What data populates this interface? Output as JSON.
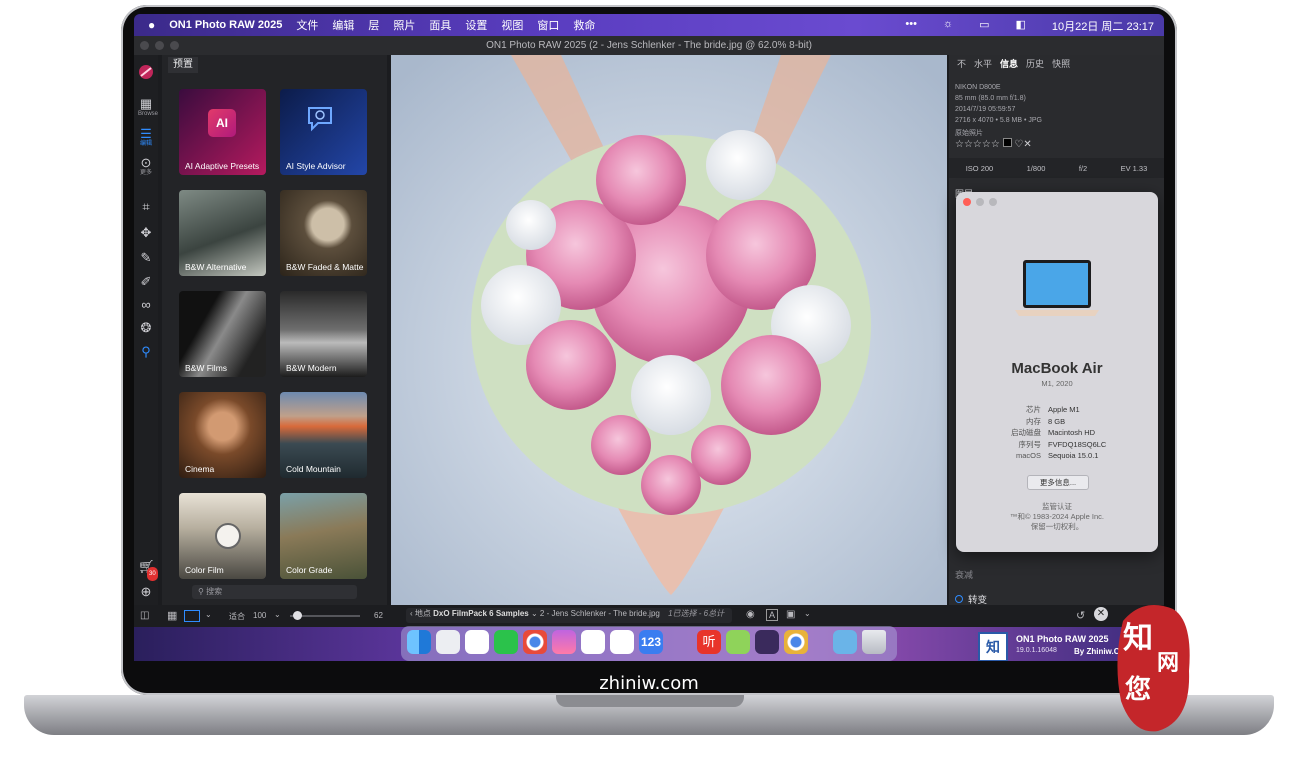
{
  "menubar": {
    "app_name": "ON1 Photo RAW 2025",
    "items": [
      "文件",
      "编辑",
      "层",
      "照片",
      "面具",
      "设置",
      "视图",
      "窗口",
      "救命"
    ],
    "clock": "10月22日 周二  23:17",
    "status_dots": "•••"
  },
  "window": {
    "title": "ON1 Photo RAW 2025 (2 - Jens Schlenker - The bride.jpg @ 62.0% 8-bit)"
  },
  "toolstrip": {
    "browse_label": "Browse",
    "edit_label": "编辑",
    "more_label": "更多",
    "cart_badge": "30"
  },
  "presets": {
    "header": "预置",
    "cards": [
      {
        "label": "AI Adaptive Presets",
        "icon_text": "AI"
      },
      {
        "label": "AI Style Advisor"
      },
      {
        "label": "B&W Alternative"
      },
      {
        "label": "B&W Faded & Matte"
      },
      {
        "label": "B&W Films"
      },
      {
        "label": "B&W Modern"
      },
      {
        "label": "Cinema"
      },
      {
        "label": "Cold Mountain"
      },
      {
        "label": "Color Film"
      },
      {
        "label": "Color Grade"
      }
    ],
    "search_placeholder": "搜索"
  },
  "info_panel": {
    "tabs": [
      "不",
      "水平",
      "信息",
      "历史",
      "快照"
    ],
    "active_tab": "信息",
    "camera": "NIKON D800E",
    "lens": "85 mm (85.0 mm f/1.8)",
    "datetime": "2014/7/19  05:59:57",
    "dims": "2716 x 4070  •  5.8 MB  •  JPG",
    "original": "原始照片",
    "stars": "☆☆☆☆☆",
    "exif": {
      "iso": "ISO 200",
      "shutter": "1/800",
      "aperture": "f/2",
      "ev": "EV 1.33"
    },
    "layers_label": "图层",
    "section_shuaijian": "衰减",
    "section_zhuanbian": "转变"
  },
  "about": {
    "model": "MacBook Air",
    "sub": "M1, 2020",
    "specs": [
      {
        "k": "芯片",
        "v": "Apple M1"
      },
      {
        "k": "内存",
        "v": "8 GB"
      },
      {
        "k": "启动磁盘",
        "v": "Macintosh HD"
      },
      {
        "k": "序列号",
        "v": "FVFDQ18SQ6LC"
      },
      {
        "k": "macOS",
        "v": "Sequoia 15.0.1"
      }
    ],
    "more_button": "更多信息...",
    "regulatory": "监管认证",
    "copyright": "™和© 1983-2024 Apple Inc.",
    "rights": "保留一切权利。"
  },
  "bottombar": {
    "fit_label": "适合",
    "zoom_value": "100",
    "slider_value": "62",
    "slider_fraction": 0.1,
    "location_label": "地点",
    "source": "DxO FilmPack 6 Samples",
    "file": "2 - Jens Schlenker - The bride.jpg",
    "selection": "1已选择 - 6总计"
  },
  "dock_banner": {
    "title": "ON1 Photo RAW 2025",
    "version": "19.0.1.16048",
    "by": "By Zhiniw.Com",
    "icon_text": "知"
  },
  "dock_text": {
    "num": "123",
    "ting": "听"
  },
  "watermark": {
    "url": "zhiniw.com",
    "seal_chars": [
      "知",
      "您",
      "网"
    ]
  }
}
